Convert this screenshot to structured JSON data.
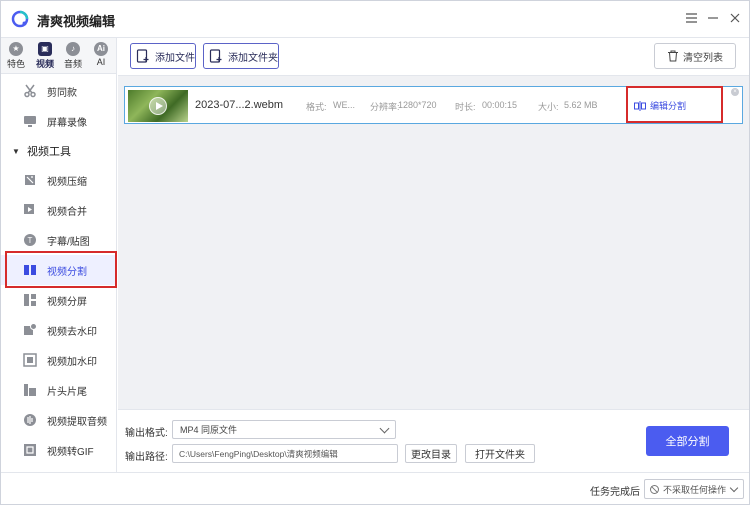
{
  "app": {
    "title": "清爽视频编辑",
    "window_buttons": [
      "menu-icon",
      "minimize-icon",
      "close-icon"
    ]
  },
  "tabs": [
    {
      "label": "特色",
      "icon": "star-icon",
      "active": false
    },
    {
      "label": "视频",
      "icon": "film-icon",
      "active": true
    },
    {
      "label": "音频",
      "icon": "music-icon",
      "active": false
    },
    {
      "label": "AI",
      "icon": "ai-icon",
      "active": false
    }
  ],
  "sidebar": {
    "top_items": [
      {
        "label": "剪同款",
        "icon": "scissors-icon"
      },
      {
        "label": "屏幕录像",
        "icon": "screen-record-icon"
      }
    ],
    "group_label": "视频工具",
    "items": [
      {
        "label": "视频压缩",
        "icon": "compress-icon"
      },
      {
        "label": "视频合并",
        "icon": "merge-icon"
      },
      {
        "label": "字幕/贴图",
        "icon": "subtitle-icon"
      },
      {
        "label": "视频分割",
        "icon": "split-icon",
        "active": true
      },
      {
        "label": "视频分屏",
        "icon": "splitscreen-icon"
      },
      {
        "label": "视频去水印",
        "icon": "remove-watermark-icon"
      },
      {
        "label": "视频加水印",
        "icon": "add-watermark-icon"
      },
      {
        "label": "片头片尾",
        "icon": "intro-outro-icon"
      },
      {
        "label": "视频提取音频",
        "icon": "extract-audio-icon"
      },
      {
        "label": "视频转GIF",
        "icon": "gif-icon"
      }
    ]
  },
  "toolbar": {
    "add_file": "添加文件",
    "add_folder": "添加文件夹",
    "clear_list": "清空列表"
  },
  "file": {
    "name": "2023-07...2.webm",
    "format_label": "格式:",
    "format_value": "WE...",
    "resolution_label": "分辨率:",
    "resolution_value": "1280*720",
    "duration_label": "时长:",
    "duration_value": "00:00:15",
    "size_label": "大小:",
    "size_value": "5.62 MB",
    "edit_split": "编辑分割"
  },
  "settings": {
    "output_format_label": "输出格式:",
    "output_format_value": "MP4  同原文件",
    "output_path_label": "输出路径:",
    "output_path_value": "C:\\Users\\FengPing\\Desktop\\清爽视频编辑",
    "change_dir": "更改目录",
    "open_folder": "打开文件夹",
    "split_all": "全部分割"
  },
  "status": {
    "after_done_label": "任务完成后",
    "after_done_value": "不采取任何操作"
  },
  "colors": {
    "accent": "#4b5cf0",
    "highlight_border": "#d62b2b",
    "selected_row_border": "#5aa8e0"
  }
}
